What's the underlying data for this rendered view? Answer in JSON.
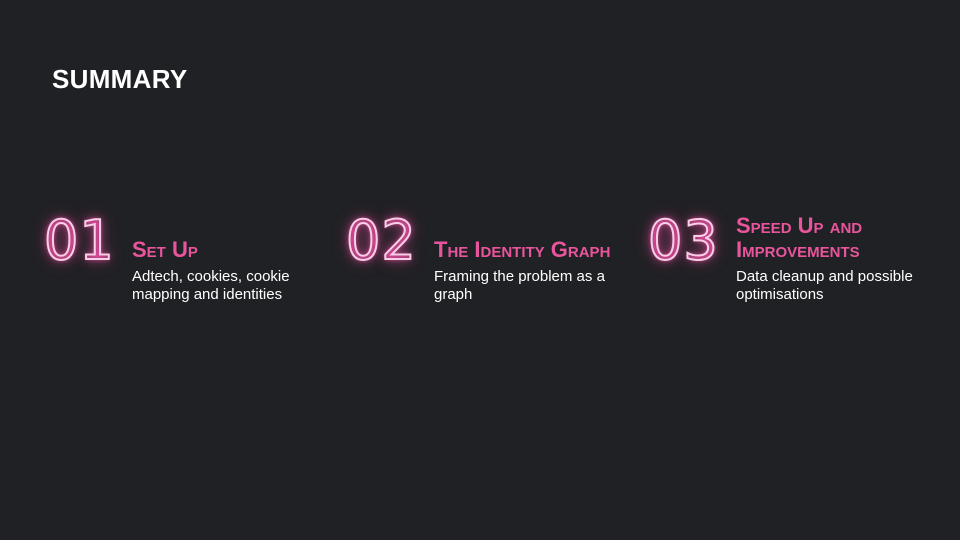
{
  "slide": {
    "title": "SUMMARY",
    "colors": {
      "background": "#202124",
      "accent": "#e9559c",
      "text": "#ffffff"
    },
    "items": [
      {
        "number": "01",
        "heading": "Set Up",
        "description": "Adtech, cookies, cookie mapping and identities"
      },
      {
        "number": "02",
        "heading": "The Identity Graph",
        "description": "Framing the problem as a graph"
      },
      {
        "number": "03",
        "heading": "Speed Up and Improvements",
        "description": "Data cleanup and possible optimisations"
      }
    ]
  }
}
